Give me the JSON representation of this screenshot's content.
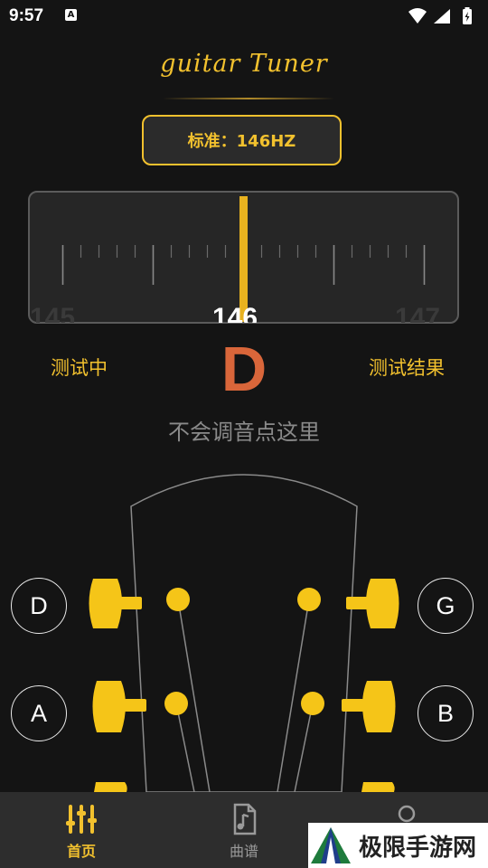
{
  "status_bar": {
    "time": "9:57",
    "badge_letter": "A"
  },
  "logo": {
    "text": "guitar Tuner"
  },
  "standard": {
    "label": "标准：146HZ"
  },
  "meter": {
    "current": "146",
    "left": "145",
    "right": "147",
    "needle_offset": 0
  },
  "testing_label": "测试中",
  "result_label": "测试结果",
  "detected_note": "D",
  "help_text": "不会调音点这里",
  "strings": {
    "left": [
      {
        "name": "D"
      },
      {
        "name": "A"
      }
    ],
    "right": [
      {
        "name": "G"
      },
      {
        "name": "B"
      }
    ]
  },
  "tabs": [
    {
      "label": "首页",
      "icon": "sliders-icon",
      "active": true
    },
    {
      "label": "曲谱",
      "icon": "music-file-icon",
      "active": false
    },
    {
      "label": "",
      "icon": "profile-icon",
      "active": false
    }
  ],
  "watermark": {
    "text": "极限手游网"
  },
  "colors": {
    "accent": "#f2c12e",
    "note": "#d9663a",
    "background": "#141414",
    "tabbar": "#2d2d2d"
  }
}
